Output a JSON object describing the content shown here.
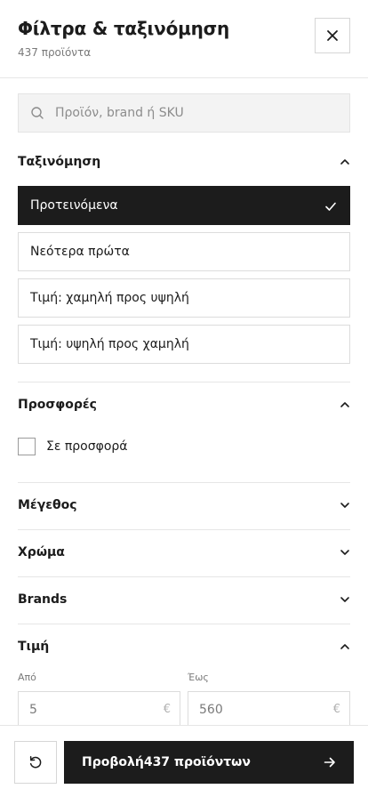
{
  "header": {
    "title": "Φίλτρα & ταξινόμηση",
    "subtitle": "437 προϊόντα",
    "close_icon": "close-icon"
  },
  "search": {
    "placeholder": "Προϊόν, brand ή SKU",
    "value": "",
    "icon": "search-icon"
  },
  "sort": {
    "title": "Ταξινόμηση",
    "expanded": true,
    "options": [
      {
        "label": "Προτεινόμενα",
        "selected": true
      },
      {
        "label": "Νεότερα πρώτα",
        "selected": false
      },
      {
        "label": "Τιμή: χαμηλή προς υψηλή",
        "selected": false
      },
      {
        "label": "Τιμή: υψηλή προς χαμηλή",
        "selected": false
      }
    ]
  },
  "offers": {
    "title": "Προσφορές",
    "expanded": true,
    "checkbox_label": "Σε προσφορά",
    "checked": false
  },
  "sections": [
    {
      "title": "Μέγεθος",
      "expanded": false
    },
    {
      "title": "Χρώμα",
      "expanded": false
    },
    {
      "title": "Brands",
      "expanded": false
    }
  ],
  "price": {
    "title": "Τιμή",
    "expanded": true,
    "from_label": "Από",
    "to_label": "Έως",
    "from_value": "5",
    "to_value": "560",
    "currency": "€"
  },
  "footer": {
    "reset_icon": "reset-icon",
    "apply_prefix": "Προβολή",
    "apply_count": "437 προϊόντων",
    "arrow_icon": "arrow-right-icon"
  },
  "colors": {
    "primary": "#1c1c1c",
    "border": "#dcdcdc",
    "muted_text": "#7a7a7a",
    "search_bg": "#f3f3f3"
  }
}
